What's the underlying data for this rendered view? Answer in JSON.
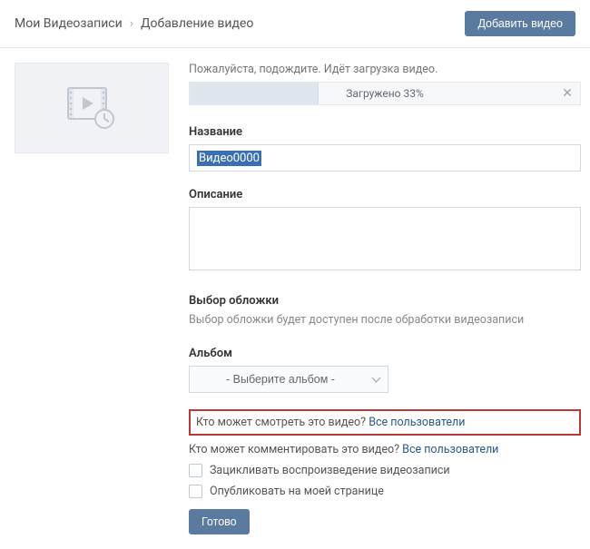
{
  "header": {
    "breadcrumb_root": "Мои Видеозаписи",
    "breadcrumb_current": "Добавление видео",
    "add_button": "Добавить видео"
  },
  "upload": {
    "wait_text": "Пожалуйста, подождите. Идёт загрузка видео.",
    "progress_percent": 33,
    "progress_text": "Загружено 33%"
  },
  "fields": {
    "title_label": "Название",
    "title_value": "Видео0000",
    "desc_label": "Описание",
    "desc_value": "",
    "cover_label": "Выбор обложки",
    "cover_hint": "Выбор обложки будет доступен после обработки видеозаписи",
    "album_label": "Альбом",
    "album_placeholder": "- Выберите альбом -"
  },
  "privacy": {
    "view_question": "Кто может смотреть это видео?",
    "view_value": "Все пользователи",
    "comment_question": "Кто может комментировать это видео?",
    "comment_value": "Все пользователи"
  },
  "options": {
    "loop_label": "Зацикливать воспроизведение видеозаписи",
    "publish_label": "Опубликовать на моей странице"
  },
  "actions": {
    "done": "Готово"
  }
}
